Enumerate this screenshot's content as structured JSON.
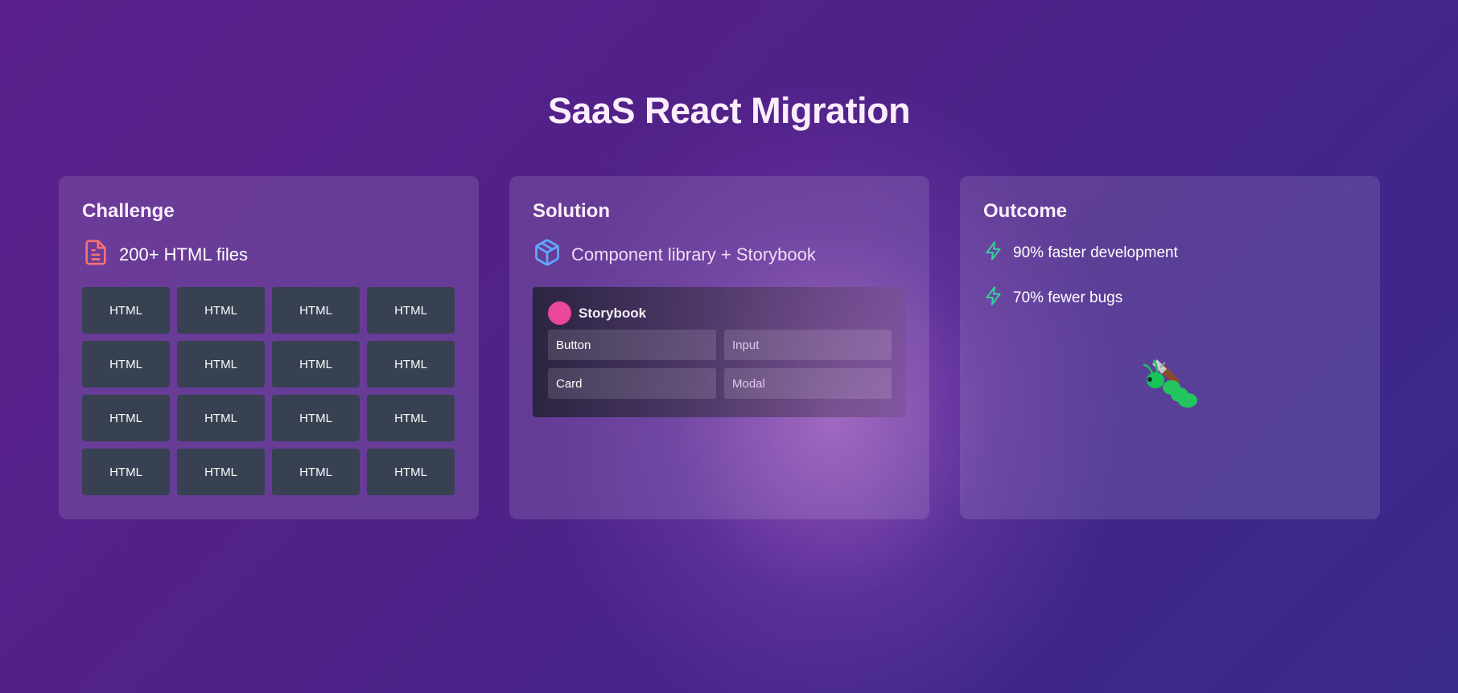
{
  "page": {
    "title": "SaaS React Migration"
  },
  "colors": {
    "file_icon": "#f87171",
    "box_icon": "#60a5fa",
    "bolt_icon": "#34d399",
    "storybook_dot": "#ec4899",
    "tile_bg": "#374151"
  },
  "challenge": {
    "heading": "Challenge",
    "icon": "file-text-icon",
    "lead": "200+ HTML files",
    "tiles": [
      "HTML",
      "HTML",
      "HTML",
      "HTML",
      "HTML",
      "HTML",
      "HTML",
      "HTML",
      "HTML",
      "HTML",
      "HTML",
      "HTML",
      "HTML",
      "HTML",
      "HTML",
      "HTML"
    ]
  },
  "solution": {
    "heading": "Solution",
    "icon": "package-icon",
    "lead": "Component library + Storybook",
    "storybook": {
      "name": "Storybook",
      "components": [
        "Button",
        "Input",
        "Card",
        "Modal"
      ]
    }
  },
  "outcome": {
    "heading": "Outcome",
    "metrics": [
      {
        "icon": "bolt-icon",
        "text": "90% faster development"
      },
      {
        "icon": "bolt-icon",
        "text": "70% fewer bugs"
      }
    ],
    "mascot": "caterpillar-mascot"
  }
}
